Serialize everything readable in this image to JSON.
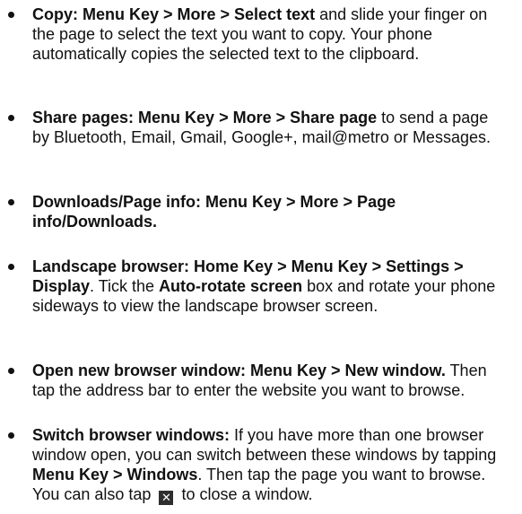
{
  "items": [
    {
      "parts": [
        {
          "text": "Copy: Menu Key > More > Select text",
          "bold": true
        },
        {
          "text": " and slide your finger on the page to select the text you want to copy. Your phone automatically copies the selected text to the clipboard.",
          "bold": false
        }
      ]
    },
    {
      "parts": [
        {
          "text": "Share pages: Menu Key > More > Share page",
          "bold": true
        },
        {
          "text": " to send a page by Bluetooth, Email, Gmail, Google+, mail@metro or Messages.",
          "bold": false
        }
      ]
    },
    {
      "parts": [
        {
          "text": "Downloads/Page info: Menu Key > More > Page info/Downloads.",
          "bold": true
        }
      ]
    },
    {
      "parts": [
        {
          "text": "Landscape browser: Home Key > Menu Key > Settings > Display",
          "bold": true
        },
        {
          "text": ". Tick the ",
          "bold": false
        },
        {
          "text": "Auto-rotate screen",
          "bold": true
        },
        {
          "text": " box and rotate your phone sideways to view the landscape browser screen.",
          "bold": false
        }
      ]
    },
    {
      "parts": [
        {
          "text": "Open new browser window: Menu Key > New window.",
          "bold": true
        },
        {
          "text": " Then tap the address bar to enter the website you want to browse.",
          "bold": false
        }
      ]
    },
    {
      "parts": [
        {
          "text": "Switch browser windows:",
          "bold": true
        },
        {
          "text": " If you have more than one browser window open, you can switch between these windows by tapping ",
          "bold": false
        },
        {
          "text": "Menu Key > Windows",
          "bold": true
        },
        {
          "text": ". Then tap the page you want to browse. You can also tap ",
          "bold": false
        },
        {
          "icon": "close-icon",
          "glyph": "✕"
        },
        {
          "text": " to close a window.",
          "bold": false
        }
      ]
    }
  ]
}
